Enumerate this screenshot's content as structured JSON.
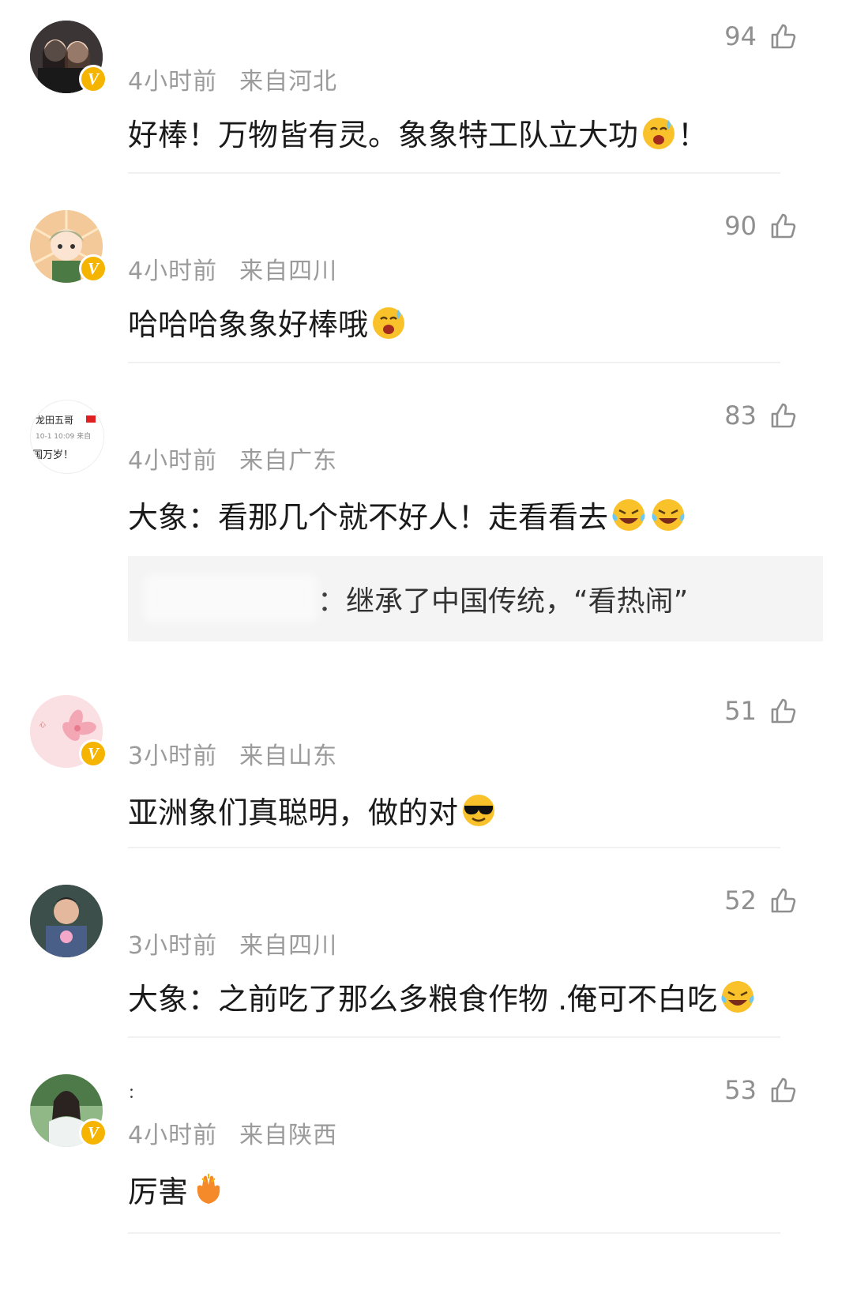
{
  "comments": [
    {
      "time": "4小时前",
      "location": "来自河北",
      "likes": "94",
      "text": "好棒！万物皆有灵。象象特工队立大功",
      "emojis": [
        "hot-face-emoji"
      ],
      "suffix": "！",
      "verified": true,
      "avatar": "two-girls-avatar"
    },
    {
      "time": "4小时前",
      "location": "来自四川",
      "likes": "90",
      "text": "哈哈哈象象好棒哦",
      "emojis": [
        "hot-face-emoji"
      ],
      "suffix": "",
      "verified": true,
      "avatar": "cartoon-character-avatar"
    },
    {
      "time": "4小时前",
      "location": "来自广东",
      "likes": "83",
      "text": "大象：看那几个就不好人！走看看去",
      "emojis": [
        "laughing-crying-emoji",
        "laughing-crying-emoji"
      ],
      "suffix": "",
      "verified": false,
      "avatar": "text-post-avatar",
      "avatar_text": {
        "line1": "龙田五哥",
        "line2": "10-1 10:09  来自",
        "line3": "国万岁！"
      },
      "reply": {
        "text": "：继承了中国传统，“看热闹”"
      }
    },
    {
      "time": "3小时前",
      "location": "来自山东",
      "likes": "51",
      "text": "亚洲象们真聪明，做的对",
      "emojis": [
        "sunglasses-emoji"
      ],
      "suffix": "",
      "verified": true,
      "avatar": "pink-flower-avatar"
    },
    {
      "time": "3小时前",
      "location": "来自四川",
      "likes": "52",
      "text": "大象：之前吃了那么多粮食作物 .俺可不白吃",
      "emojis": [
        "laughing-crying-emoji"
      ],
      "suffix": "",
      "verified": false,
      "avatar": "person-with-lotus-avatar"
    },
    {
      "time": "4小时前",
      "location": "来自陕西",
      "likes": "53",
      "text": "厉害",
      "emojis": [
        "clapping-hands-emoji"
      ],
      "suffix": "",
      "verified": true,
      "avatar": "ancient-costume-girl-avatar",
      "username": "："
    }
  ],
  "verified_badge": "V",
  "colors": {
    "meta": "#9b9b9b",
    "text": "#1a1a1a",
    "badge": "#f5b400",
    "reply_bg": "#f4f4f4"
  }
}
